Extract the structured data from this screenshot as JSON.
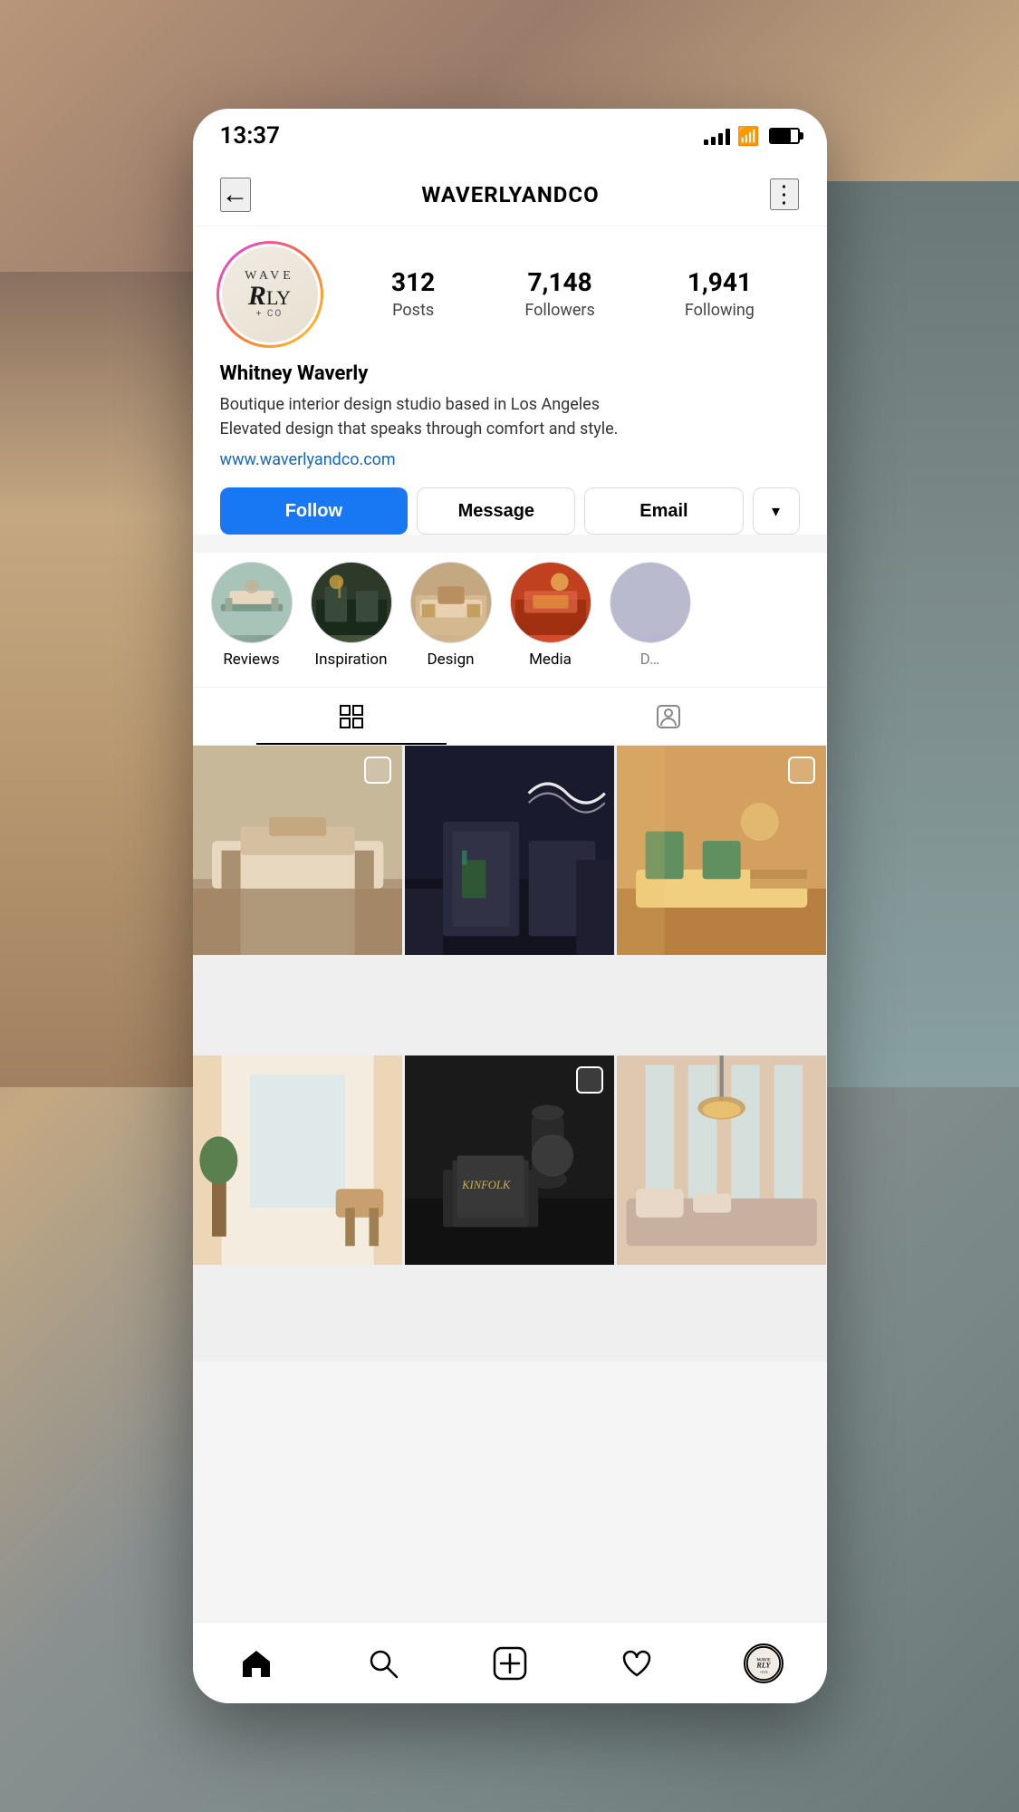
{
  "status_bar": {
    "time": "13:37"
  },
  "header": {
    "title": "WAVERLYANDCO",
    "back_label": "←",
    "more_label": "⋮"
  },
  "profile": {
    "name": "Whitney Waverly",
    "bio": "Boutique interior design studio based in Los Angeles\nElevated design that speaks through comfort and style.",
    "link": "www.waverlyandco.com",
    "stats": {
      "posts": "312",
      "posts_label": "Posts",
      "followers": "7,148",
      "followers_label": "Followers",
      "following": "1,941",
      "following_label": "Following"
    },
    "avatar_line1": "WAVE",
    "avatar_line2": "RLY",
    "avatar_line3": "+ CO"
  },
  "buttons": {
    "follow": "Follow",
    "message": "Message",
    "email": "Email",
    "dropdown": "▾"
  },
  "highlights": [
    {
      "id": "reviews",
      "label": "Reviews",
      "class": "hl-reviews"
    },
    {
      "id": "inspiration",
      "label": "Inspiration",
      "class": "hl-inspiration"
    },
    {
      "id": "design",
      "label": "Design",
      "class": "hl-design"
    },
    {
      "id": "media",
      "label": "Media",
      "class": "hl-media"
    }
  ],
  "tabs": [
    {
      "id": "grid",
      "icon": "grid",
      "active": true
    },
    {
      "id": "tagged",
      "icon": "person",
      "active": false
    }
  ],
  "grid_items": [
    {
      "id": 1,
      "multi": true,
      "class": "gi-1"
    },
    {
      "id": 2,
      "multi": false,
      "class": "gi-2"
    },
    {
      "id": 3,
      "multi": true,
      "class": "gi-3"
    },
    {
      "id": 4,
      "multi": false,
      "class": "gi-4"
    },
    {
      "id": 5,
      "multi": true,
      "class": "gi-5"
    },
    {
      "id": 6,
      "multi": false,
      "class": "gi-6"
    }
  ],
  "bottom_nav": [
    {
      "id": "home",
      "icon": "home",
      "active": true
    },
    {
      "id": "search",
      "icon": "search"
    },
    {
      "id": "add",
      "icon": "add"
    },
    {
      "id": "heart",
      "icon": "heart"
    },
    {
      "id": "profile",
      "icon": "avatar"
    }
  ],
  "colors": {
    "follow_bg": "#1878f3",
    "accent_blue": "#1565c0"
  }
}
